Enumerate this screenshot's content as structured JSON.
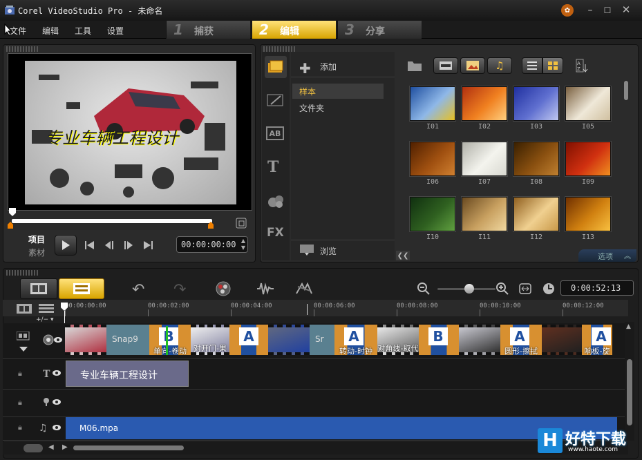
{
  "app": {
    "title": "Corel VideoStudio Pro - 未命名"
  },
  "menu": {
    "items": [
      "文件",
      "编辑",
      "工具",
      "设置"
    ]
  },
  "steps": [
    {
      "num": "1",
      "label": "捕获"
    },
    {
      "num": "2",
      "label": "编辑"
    },
    {
      "num": "3",
      "label": "分享"
    }
  ],
  "preview": {
    "overlay_text": "专业车辆工程设计",
    "mode_project": "项目",
    "mode_clip": "素材",
    "timecode": "00:00:00:00"
  },
  "library": {
    "add_label": "添加",
    "folders": [
      "样本",
      "文件夹"
    ],
    "browse_label": "浏览",
    "options_label": "选项",
    "category_icons": [
      "T",
      "FX"
    ],
    "thumbs": [
      {
        "id": "I01",
        "c1": "#1f4fa0",
        "c2": "#8fb8e8",
        "c3": "#e8c020"
      },
      {
        "id": "I02",
        "c1": "#b03010",
        "c2": "#f08020",
        "c3": "#ffd080"
      },
      {
        "id": "I03",
        "c1": "#2030a0",
        "c2": "#6070d0",
        "c3": "#c0c8f0"
      },
      {
        "id": "I05",
        "c1": "#7a6040",
        "c2": "#efe8d8",
        "c3": "#d0c0a0"
      },
      {
        "id": "I06",
        "c1": "#502000",
        "c2": "#a05010",
        "c3": "#d08030"
      },
      {
        "id": "I07",
        "c1": "#b0b0a8",
        "c2": "#f4f4ee",
        "c3": "#d8d8d0"
      },
      {
        "id": "I08",
        "c1": "#3a2000",
        "c2": "#8a5010",
        "c3": "#c08030"
      },
      {
        "id": "I09",
        "c1": "#801000",
        "c2": "#d03010",
        "c3": "#f09020"
      },
      {
        "id": "I10",
        "c1": "#103010",
        "c2": "#2f6020",
        "c3": "#60a040"
      },
      {
        "id": "I11",
        "c1": "#6a4a20",
        "c2": "#c8a060",
        "c3": "#f0d8a0"
      },
      {
        "id": "I12",
        "c1": "#906020",
        "c2": "#f0d090",
        "c3": "#c89848"
      },
      {
        "id": "I13",
        "c1": "#703000",
        "c2": "#d08010",
        "c3": "#f8c040"
      }
    ]
  },
  "timeline": {
    "timecode": "0:00:52:13",
    "ticks": [
      "00:00:00:00",
      "00:00:02:00",
      "00:00:04:00",
      "00:00:06:00",
      "00:00:08:00",
      "00:00:10:00",
      "00:00:12:00"
    ],
    "video_clips": [
      {
        "kind": "photo",
        "c1": "#d8d8d8",
        "c2": "#b03040",
        "cap": ""
      },
      {
        "kind": "snap",
        "c1": "#5a8090",
        "c2": "#5a8090",
        "cap": "Snap9"
      },
      {
        "kind": "tr",
        "c1": "#d89030",
        "c2": "#2050a0",
        "cap": "单向-卷动",
        "glyph": "B"
      },
      {
        "kind": "photo",
        "c1": "#eeeeee",
        "c2": "#8080a0",
        "cap": "对开门-果"
      },
      {
        "kind": "tr",
        "c1": "#d89030",
        "c2": "#2050a0",
        "cap": "",
        "glyph": "A"
      },
      {
        "kind": "photo",
        "c1": "#606880",
        "c2": "#2040a0",
        "cap": ""
      },
      {
        "kind": "snap",
        "c1": "#5a8090",
        "c2": "#5a8090",
        "cap": "Sr"
      },
      {
        "kind": "tr",
        "c1": "#d89030",
        "c2": "#2050a0",
        "cap": "转动-时钟",
        "glyph": "A"
      },
      {
        "kind": "photo",
        "c1": "#e8e8e8",
        "c2": "#606060",
        "cap": "对角线-取代"
      },
      {
        "kind": "tr",
        "c1": "#d89030",
        "c2": "#2050a0",
        "cap": "",
        "glyph": "B"
      },
      {
        "kind": "photo",
        "c1": "#c8c8d0",
        "c2": "#303030",
        "cap": ""
      },
      {
        "kind": "tr",
        "c1": "#d89030",
        "c2": "#2050a0",
        "cap": "圆形-擦拭",
        "glyph": "A"
      },
      {
        "kind": "photo",
        "c1": "#603020",
        "c2": "#202020",
        "cap": ""
      },
      {
        "kind": "tr",
        "c1": "#d89030",
        "c2": "#2050a0",
        "cap": "响板-旋",
        "glyph": "A"
      }
    ],
    "title_clip": "专业车辆工程设计",
    "music_clip": "M06.mpa",
    "add_track_label": "+/− ▾"
  },
  "watermark": {
    "name": "好特下载",
    "url": "www.haote.com"
  }
}
